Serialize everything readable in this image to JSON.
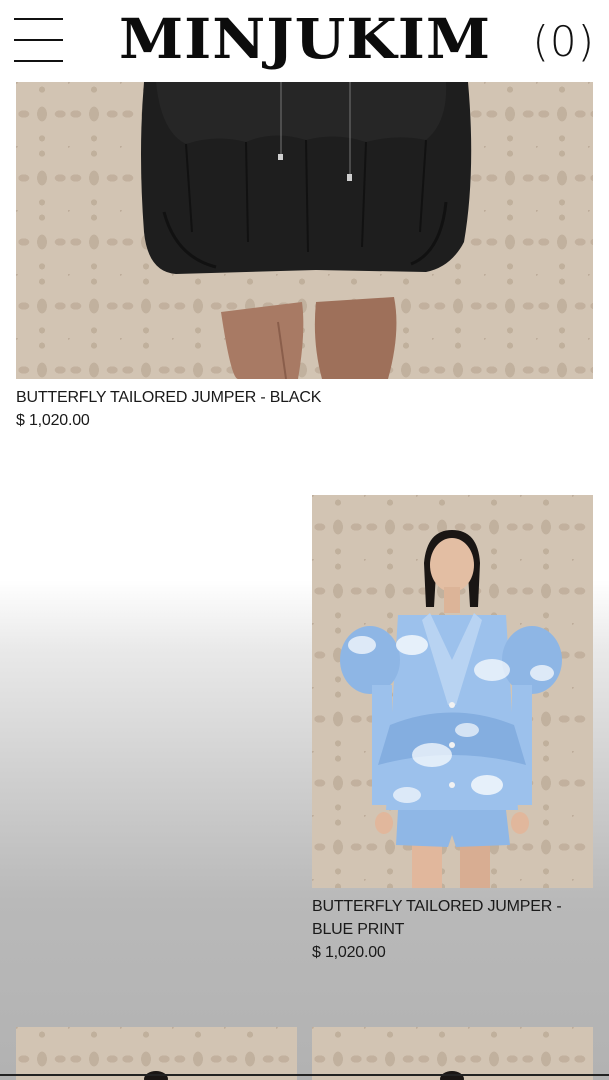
{
  "header": {
    "logo": "MINJUKIM",
    "cart_label": "(0)",
    "menu_icon": "hamburger-menu-icon"
  },
  "products": [
    {
      "name": "BUTTERFLY TAILORED JUMPER - BLACK",
      "price": "$ 1,020.00"
    },
    {
      "name": "BUTTERFLY TAILORED JUMPER - BLUE PRINT",
      "price": "$ 1,020.00"
    }
  ],
  "colors": {
    "background": "#ffffff",
    "wallpaper": "#d2c4b3",
    "black_garment": "#1c1c1c",
    "blue_print": "#8fb7e6"
  }
}
